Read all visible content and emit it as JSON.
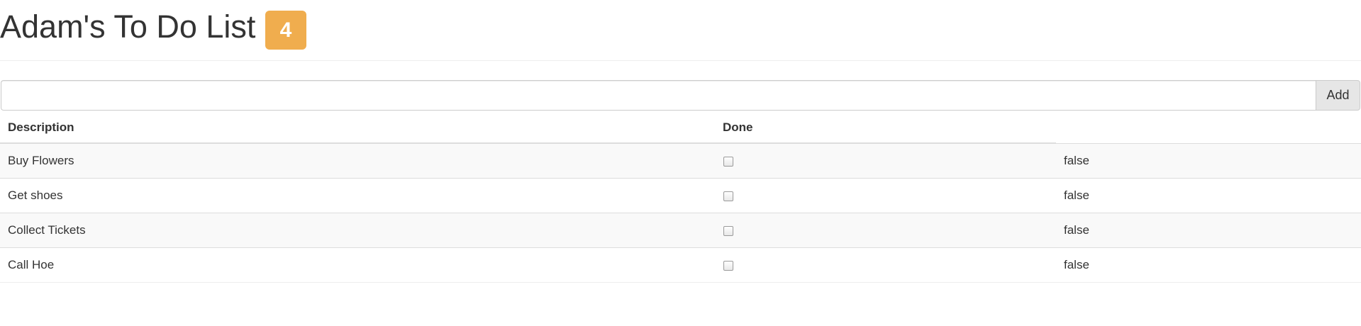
{
  "header": {
    "title": "Adam's To Do List",
    "badge_count": "4",
    "badge_color": "#f0ad4e"
  },
  "new_task": {
    "value": "",
    "placeholder": "",
    "add_label": "Add"
  },
  "table": {
    "columns": [
      "Description",
      "Done",
      ""
    ],
    "rows": [
      {
        "description": "Buy Flowers",
        "done": false,
        "done_text": "false"
      },
      {
        "description": "Get shoes",
        "done": false,
        "done_text": "false"
      },
      {
        "description": "Collect Tickets",
        "done": false,
        "done_text": "false"
      },
      {
        "description": "Call Hoe",
        "done": false,
        "done_text": "false"
      }
    ]
  }
}
